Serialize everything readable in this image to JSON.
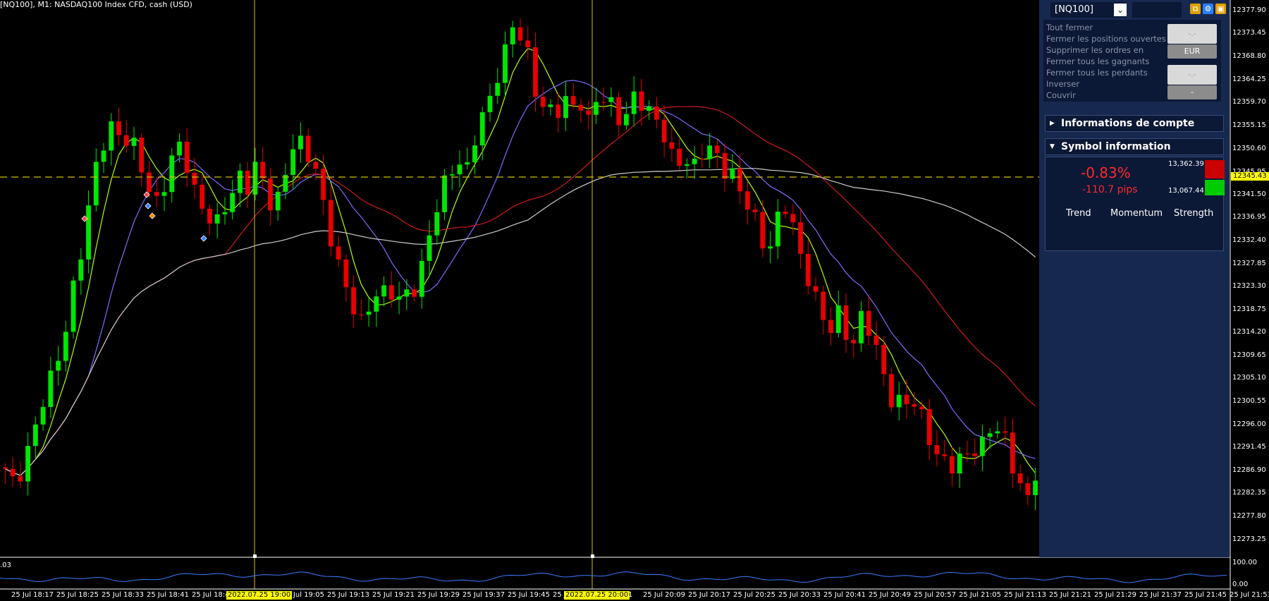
{
  "chart_header": {
    "title": "[NQ100], M1:  NASDAQ100 Index CFD, cash (USD)"
  },
  "oscillator": {
    "value_label": ".03",
    "scale_top": "100.00",
    "scale_bottom": "0.00"
  },
  "vertical_markers": [
    {
      "label": "2022.07.25 19:00"
    },
    {
      "label": "2022.07.25 20:00"
    }
  ],
  "current_price_label": "12345.43",
  "panel": {
    "symbol_select": "[NQ100]",
    "actions": [
      "Tout fermer",
      "Fermer les positions ouvertes",
      "Supprimer les ordres en",
      "Fermer tous les gagnants",
      "Fermer tous les perdants",
      "Inverser",
      "Couvrir"
    ],
    "buttons": {
      "top_value": "-.-",
      "currency": "EUR",
      "bottom_value": "-.-",
      "bottom_dash": "-"
    },
    "sections": {
      "account": "Informations de compte",
      "symbol": "Symbol information"
    },
    "symbol_info": {
      "change_pct": "-0.83%",
      "change_pips": "-110.7 pips",
      "high": "13,362.39",
      "low": "13,067.44",
      "trend_label": "Trend",
      "momentum_label": "Momentum",
      "strength_label": "Strength"
    },
    "colors": {
      "panel_bg": "#17284f",
      "down": "#ff2a2a",
      "up": "#00cc00"
    }
  },
  "chart_data": {
    "type": "candlestick",
    "price_axis_ticks": [
      "12377.90",
      "12373.45",
      "12368.80",
      "12364.25",
      "12359.70",
      "12355.15",
      "12350.60",
      "12345.95",
      "12341.50",
      "12336.95",
      "12332.40",
      "12327.85",
      "12323.30",
      "12318.75",
      "12314.20",
      "12309.65",
      "12305.10",
      "12300.55",
      "12296.00",
      "12291.45",
      "12286.90",
      "12282.35",
      "12277.80",
      "12273.25"
    ],
    "time_axis_ticks": [
      "25 Jul 18:17",
      "25 Jul 18:25",
      "25 Jul 18:33",
      "25 Jul 18:41",
      "25 Jul 18:49",
      "25 Jul 19:05",
      "25 Jul 19:13",
      "25 Jul 19:21",
      "25 Jul 19:29",
      "25 Jul 19:37",
      "25 Jul 19:45",
      "25 J",
      "0:01",
      "25 Jul 20:09",
      "25 Jul 20:17",
      "25 Jul 20:25",
      "25 Jul 20:33",
      "25 Jul 20:41",
      "25 Jul 20:49",
      "25 Jul 20:57",
      "25 Jul 21:05",
      "25 Jul 21:13",
      "25 Jul 21:21",
      "25 Jul 21:29",
      "25 Jul 21:37",
      "25 Jul 21:45",
      "25 Jul 21:53"
    ],
    "y_range": [
      12270.4,
      12380.0
    ],
    "horizontal_level": 12345.43,
    "candle_colors": {
      "up": "#00e600",
      "down": "#e60000"
    },
    "series": [
      {
        "name": "",
        "color": "#b4ff00",
        "role": "fast ma"
      },
      {
        "name": "",
        "color": "#7a6cff",
        "role": "mid ma"
      },
      {
        "name": "",
        "color": "#d01a1a",
        "role": "slow ma"
      },
      {
        "name": "",
        "color": "#cccccc",
        "role": "long ma"
      }
    ],
    "close_path": [
      12286,
      12284,
      12287,
      12292,
      12296,
      12300,
      12304,
      12309,
      12316,
      12324,
      12330,
      12338,
      12346,
      12352,
      12356,
      12354,
      12352,
      12350,
      12346,
      12343,
      12341,
      12344,
      12348,
      12350,
      12347,
      12343,
      12340,
      12337,
      12335,
      12338,
      12342,
      12346,
      12344,
      12347,
      12343,
      12339,
      12341,
      12347,
      12352,
      12351,
      12348,
      12346,
      12340,
      12334,
      12328,
      12322,
      12318,
      12316,
      12320,
      12323,
      12322,
      12321,
      12320,
      12322,
      12324,
      12328,
      12333,
      12338,
      12343,
      12347,
      12349,
      12347,
      12352,
      12356,
      12360,
      12366,
      12371,
      12375,
      12372,
      12368,
      12362,
      12360,
      12359,
      12358,
      12359,
      12358,
      12360,
      12357,
      12361,
      12360,
      12358,
      12356,
      12358,
      12362,
      12360,
      12357,
      12355,
      12353,
      12350,
      12349,
      12348,
      12346,
      12349,
      12351,
      12350,
      12347,
      12345,
      12341,
      12339,
      12337,
      12333,
      12332,
      12336,
      12338,
      12335,
      12330,
      12326,
      12321,
      12316,
      12314,
      12318,
      12315,
      12313,
      12317,
      12314,
      12310,
      12306,
      12302,
      12301,
      12300,
      12299,
      12297,
      12294,
      12291,
      12289,
      12287,
      12288,
      12290,
      12292,
      12293,
      12295,
      12294,
      12292,
      12288,
      12285,
      12282,
      12286
    ]
  }
}
